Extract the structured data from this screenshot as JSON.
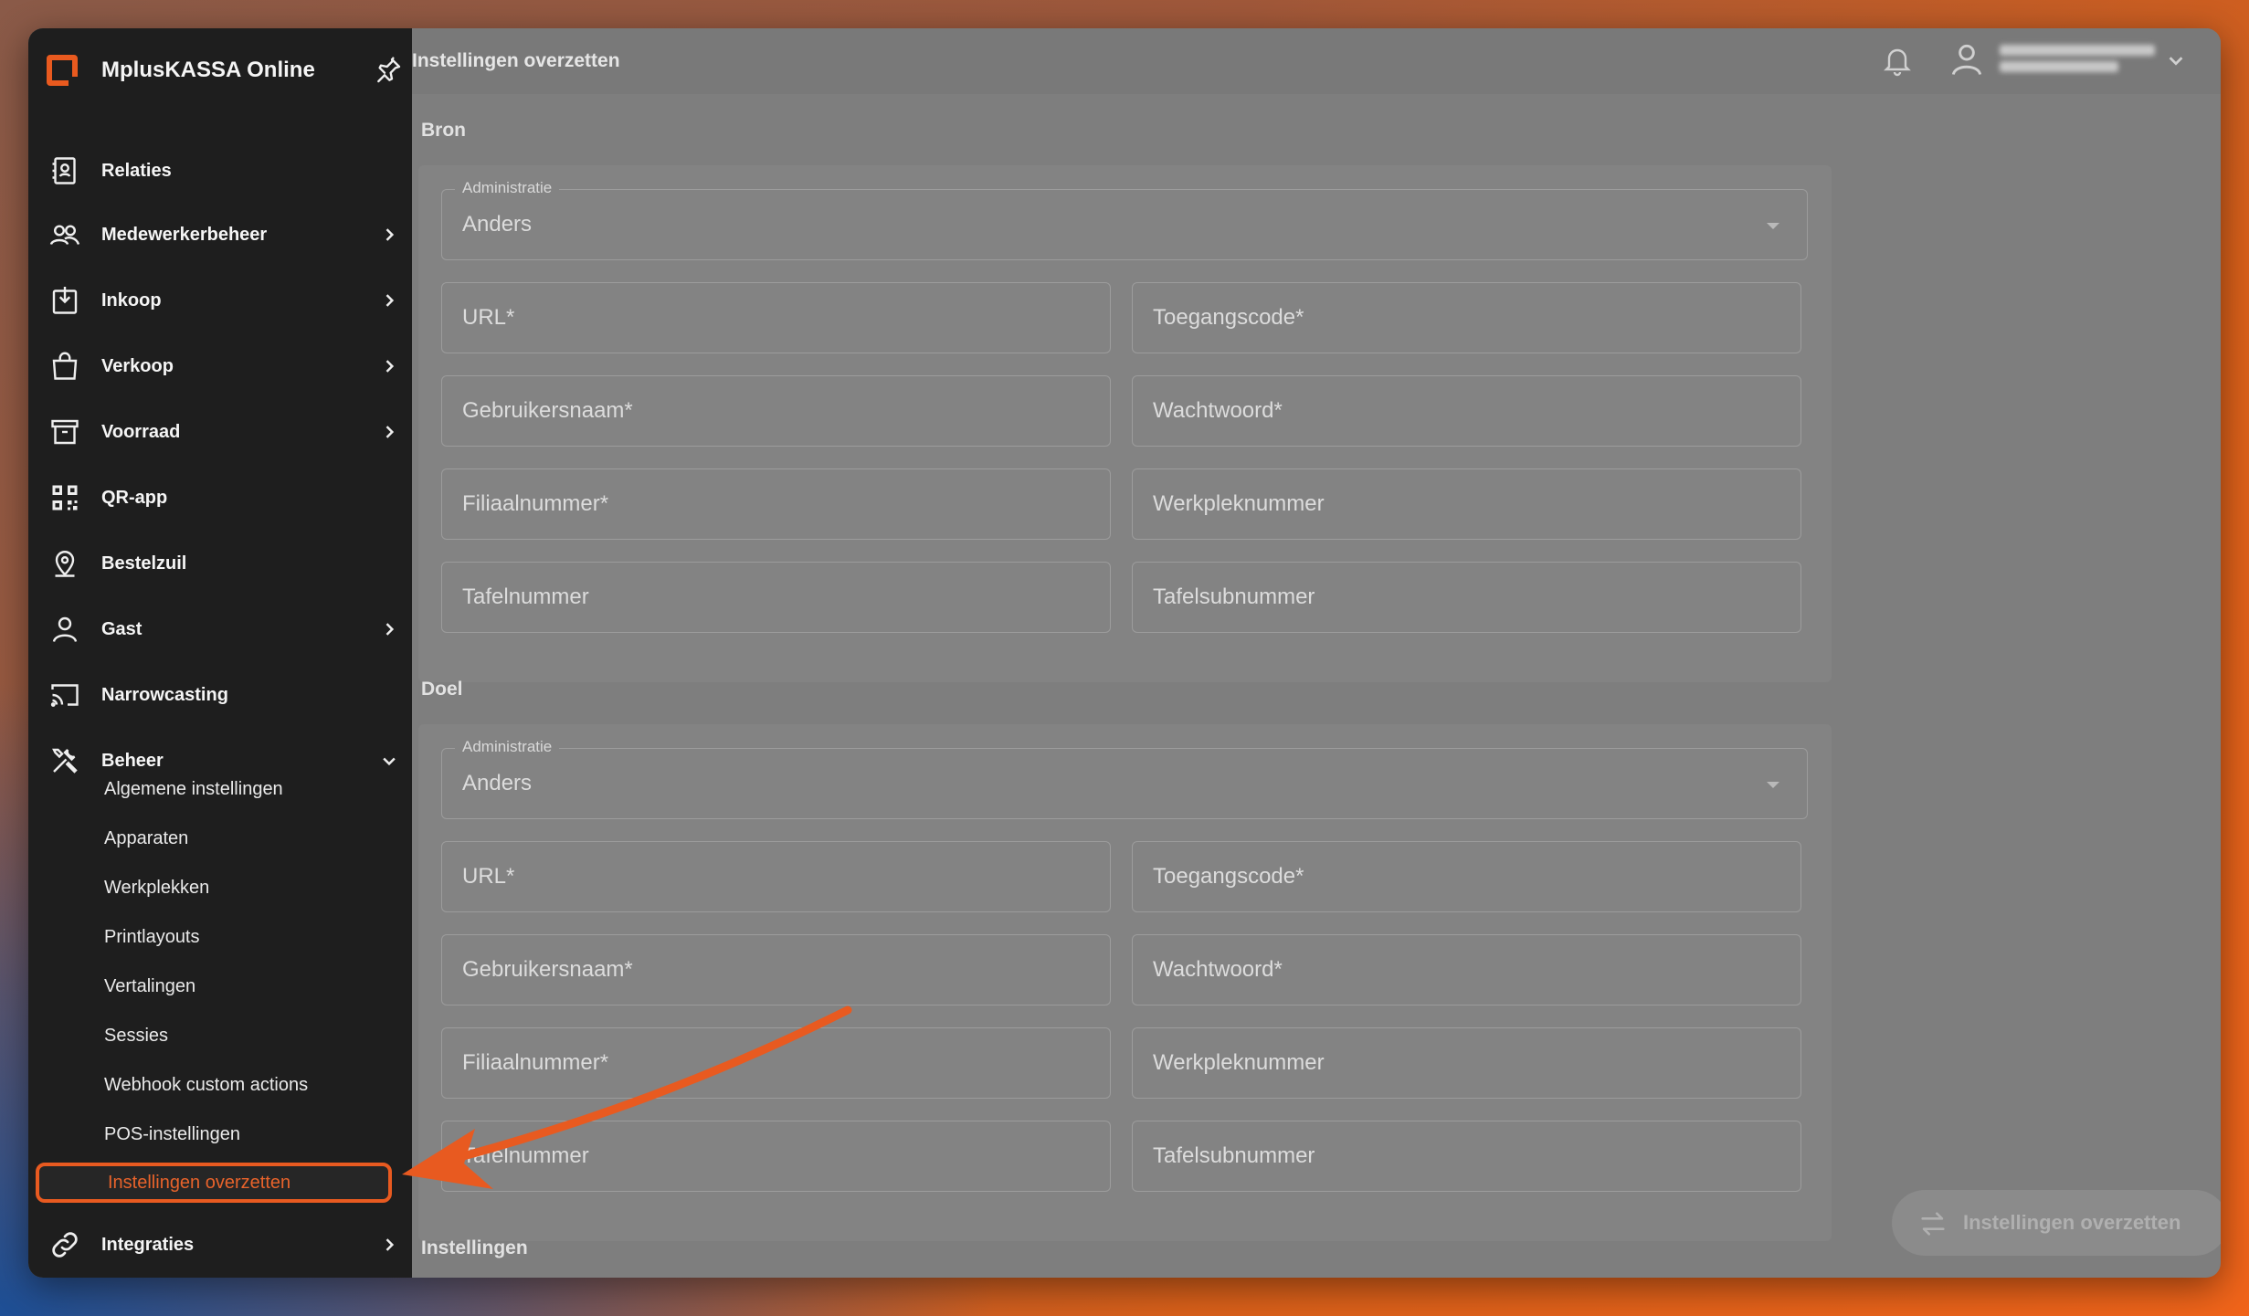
{
  "app": {
    "name": "MplusKASSA Online"
  },
  "sidebar": {
    "items": [
      {
        "label": "Relaties",
        "icon": "contacts-book-icon",
        "expandable": false
      },
      {
        "label": "Medewerkerbeheer",
        "icon": "users-icon",
        "expandable": true
      },
      {
        "label": "Inkoop",
        "icon": "clipboard-download-icon",
        "expandable": true
      },
      {
        "label": "Verkoop",
        "icon": "shopping-bag-icon",
        "expandable": true
      },
      {
        "label": "Voorraad",
        "icon": "archive-box-icon",
        "expandable": true
      },
      {
        "label": "QR-app",
        "icon": "qr-code-icon",
        "expandable": false
      },
      {
        "label": "Bestelzuil",
        "icon": "location-pin-icon",
        "expandable": false
      },
      {
        "label": "Gast",
        "icon": "user-icon",
        "expandable": true
      },
      {
        "label": "Narrowcasting",
        "icon": "cast-icon",
        "expandable": false
      },
      {
        "label": "Beheer",
        "icon": "tools-icon",
        "expandable": true,
        "expanded": true
      }
    ],
    "beheer_sub": [
      "Algemene instellingen",
      "Apparaten",
      "Werkplekken",
      "Printlayouts",
      "Vertalingen",
      "Sessies",
      "Webhook custom actions",
      "POS-instellingen"
    ],
    "active_sub": "Instellingen overzetten",
    "last_item": {
      "label": "Integraties",
      "icon": "link-icon",
      "expandable": true
    }
  },
  "header": {
    "title": "Instellingen overzetten"
  },
  "bron": {
    "label": "Bron",
    "admin_label": "Administratie",
    "admin_value": "Anders",
    "url": "URL*",
    "code": "Toegangscode*",
    "user": "Gebruikersnaam*",
    "password": "Wachtwoord*",
    "branch": "Filiaalnummer*",
    "workstation": "Werkpleknummer",
    "table": "Tafelnummer",
    "subtable": "Tafelsubnummer"
  },
  "doel": {
    "label": "Doel",
    "admin_label": "Administratie",
    "admin_value": "Anders",
    "url": "URL*",
    "code": "Toegangscode*",
    "user": "Gebruikersnaam*",
    "password": "Wachtwoord*",
    "branch": "Filiaalnummer*",
    "workstation": "Werkpleknummer",
    "table": "Tafelnummer",
    "subtable": "Tafelsubnummer"
  },
  "instellingen": {
    "label": "Instellingen"
  },
  "action": {
    "submit_label": "Instellingen overzetten"
  },
  "colors": {
    "accent": "#e85a20",
    "sidebar": "#1e1e1e",
    "overlay": "#7e7e7e"
  }
}
